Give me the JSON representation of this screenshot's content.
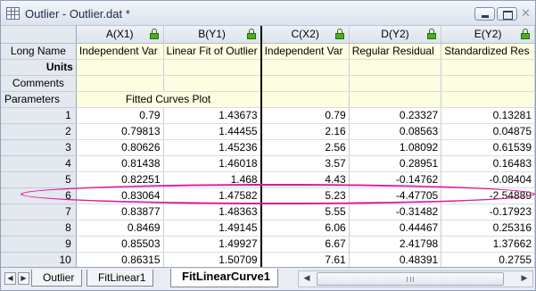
{
  "window": {
    "title": "Outlier - Outlier.dat *"
  },
  "columns": [
    {
      "header": "A(X1)",
      "long_name": "Independent Var"
    },
    {
      "header": "B(Y1)",
      "long_name": "Linear Fit of Outlier"
    },
    {
      "header": "C(X2)",
      "long_name": "Independent Var"
    },
    {
      "header": "D(Y2)",
      "long_name": "Regular Residual"
    },
    {
      "header": "E(Y2)",
      "long_name": "Standardized Res"
    }
  ],
  "row_labels": {
    "long_name": "Long Name",
    "units": "Units",
    "comments": "Comments",
    "parameters": "Parameters"
  },
  "parameters_value": "Fitted Curves Plot",
  "rows": [
    {
      "n": "1",
      "cells": [
        "0.79",
        "1.43673",
        "0.79",
        "0.23327",
        "0.13281"
      ]
    },
    {
      "n": "2",
      "cells": [
        "0.79813",
        "1.44455",
        "2.16",
        "0.08563",
        "0.04875"
      ]
    },
    {
      "n": "3",
      "cells": [
        "0.80626",
        "1.45236",
        "2.56",
        "1.08092",
        "0.61539"
      ]
    },
    {
      "n": "4",
      "cells": [
        "0.81438",
        "1.46018",
        "3.57",
        "0.28951",
        "0.16483"
      ]
    },
    {
      "n": "5",
      "cells": [
        "0.82251",
        "1.468",
        "4.43",
        "-0.14762",
        "-0.08404"
      ]
    },
    {
      "n": "6",
      "cells": [
        "0.83064",
        "1.47582",
        "5.23",
        "-4.47705",
        "-2.54889"
      ]
    },
    {
      "n": "7",
      "cells": [
        "0.83877",
        "1.48363",
        "5.55",
        "-0.31482",
        "-0.17923"
      ]
    },
    {
      "n": "8",
      "cells": [
        "0.8469",
        "1.49145",
        "6.06",
        "0.44467",
        "0.25316"
      ]
    },
    {
      "n": "9",
      "cells": [
        "0.85503",
        "1.49927",
        "6.67",
        "2.41798",
        "1.37662"
      ]
    },
    {
      "n": "10",
      "cells": [
        "0.86315",
        "1.50709",
        "7.61",
        "0.48391",
        "0.2755"
      ]
    }
  ],
  "tabs": [
    "Outlier",
    "FitLinear1",
    "FitLinearCurve1"
  ],
  "active_tab": "FitLinearCurve1",
  "highlight_color": "#e0199b"
}
